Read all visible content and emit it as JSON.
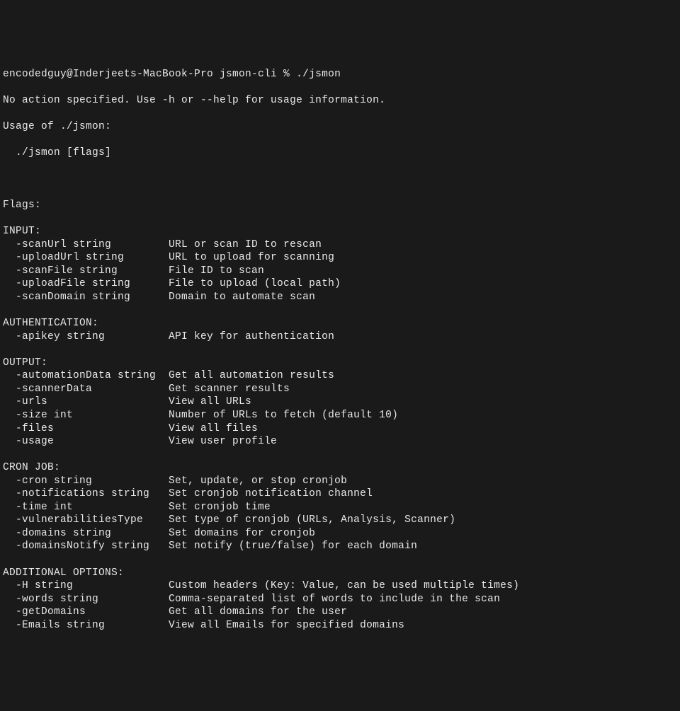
{
  "prompt": "encodedguy@Inderjeets-MacBook-Pro jsmon-cli % ./jsmon",
  "error_line": "No action specified. Use -h or --help for usage information.",
  "usage_header": "Usage of ./jsmon:",
  "usage_command": "  ./jsmon [flags]",
  "flags_header": "Flags:",
  "sections": [
    {
      "title": "INPUT:",
      "flags": [
        {
          "flag": "  -scanUrl string",
          "desc": "URL or scan ID to rescan"
        },
        {
          "flag": "  -uploadUrl string",
          "desc": "URL to upload for scanning"
        },
        {
          "flag": "  -scanFile string",
          "desc": "File ID to scan"
        },
        {
          "flag": "  -uploadFile string",
          "desc": "File to upload (local path)"
        },
        {
          "flag": "  -scanDomain string",
          "desc": "Domain to automate scan"
        }
      ]
    },
    {
      "title": "AUTHENTICATION:",
      "flags": [
        {
          "flag": "  -apikey string",
          "desc": "API key for authentication"
        }
      ]
    },
    {
      "title": "OUTPUT:",
      "flags": [
        {
          "flag": "  -automationData string",
          "desc": "Get all automation results"
        },
        {
          "flag": "  -scannerData",
          "desc": "Get scanner results"
        },
        {
          "flag": "  -urls",
          "desc": "View all URLs"
        },
        {
          "flag": "  -size int",
          "desc": "Number of URLs to fetch (default 10)"
        },
        {
          "flag": "  -files",
          "desc": "View all files"
        },
        {
          "flag": "  -usage",
          "desc": "View user profile"
        }
      ]
    },
    {
      "title": "CRON JOB:",
      "flags": [
        {
          "flag": "  -cron string",
          "desc": "Set, update, or stop cronjob"
        },
        {
          "flag": "  -notifications string",
          "desc": "Set cronjob notification channel"
        },
        {
          "flag": "  -time int",
          "desc": "Set cronjob time"
        },
        {
          "flag": "  -vulnerabilitiesType",
          "desc": "Set type of cronjob (URLs, Analysis, Scanner)"
        },
        {
          "flag": "  -domains string",
          "desc": "Set domains for cronjob"
        },
        {
          "flag": "  -domainsNotify string",
          "desc": "Set notify (true/false) for each domain"
        }
      ]
    },
    {
      "title": "ADDITIONAL OPTIONS:",
      "flags": [
        {
          "flag": "  -H string",
          "desc": "Custom headers (Key: Value, can be used multiple times)"
        },
        {
          "flag": "  -words string",
          "desc": "Comma-separated list of words to include in the scan"
        },
        {
          "flag": "  -getDomains",
          "desc": "Get all domains for the user"
        },
        {
          "flag": "  -Emails string",
          "desc": "View all Emails for specified domains"
        }
      ]
    }
  ],
  "flag_column_width": 26
}
